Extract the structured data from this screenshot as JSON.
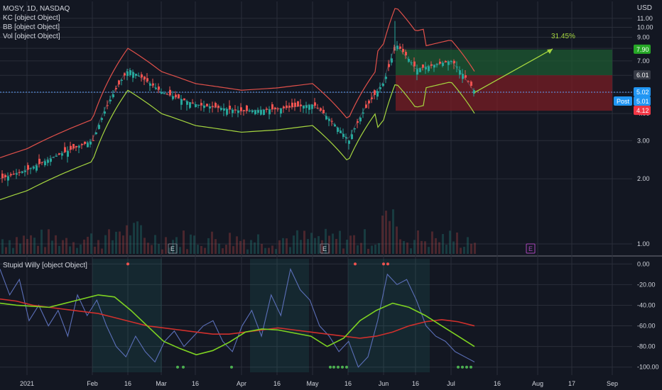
{
  "header": {
    "title": "MOSY, 1D, NASDAQ",
    "indicators": [
      "KC [object Object]",
      "BB [object Object]",
      "Vol [object Object]"
    ],
    "currency": "USD"
  },
  "lower_pane": {
    "title": "Stupid Willy [object Object]"
  },
  "colors": {
    "background": "#131722",
    "grid": "#2a2e39",
    "up": "#26a69a",
    "down": "#ef5350",
    "kc_line": "#e0504a",
    "bb_lower": "#a5d63f",
    "willy": "#5b6fb8",
    "signal_green": "#7ed321",
    "signal_red": "#d0302c",
    "target_zone": "#1e5a32",
    "stop_zone": "#7a1e24"
  },
  "price_badges": [
    {
      "label": "7.90",
      "color": "#26a826"
    },
    {
      "label": "6.01",
      "color": "#363a45"
    },
    {
      "label": "5.02",
      "color": "#2196f3"
    },
    {
      "label": "5.01",
      "color": "#2196f3",
      "prefix": "Post"
    },
    {
      "label": "4.12",
      "color": "#f23645"
    }
  ],
  "position_label": "31.45%",
  "earnings_markers": [
    "E",
    "E",
    "E"
  ],
  "chart_data": [
    {
      "type": "candlestick",
      "title": "MOSY, 1D, NASDAQ",
      "scale": "log",
      "ylim": [
        0.9,
        11.5
      ],
      "y_ticks": [
        "11.00",
        "10.00",
        "9.00",
        "8.00",
        "7.00",
        "6.00",
        "5.00",
        "4.00",
        "3.00",
        "2.00",
        "1.00"
      ],
      "x_ticks": [
        "2021",
        "Feb",
        "16",
        "Mar",
        "16",
        "Apr",
        "16",
        "May",
        "16",
        "Jun",
        "16",
        "Jul",
        "16",
        "Aug",
        "17",
        "Sep"
      ],
      "close_points": [
        [
          "2021",
          2.2
        ],
        [
          "Feb",
          3.0
        ],
        [
          "Feb-16",
          6.4
        ],
        [
          "Mar",
          5.0
        ],
        [
          "Mar-16",
          4.4
        ],
        [
          "Apr",
          4.1
        ],
        [
          "Apr-16",
          4.2
        ],
        [
          "May",
          4.4
        ],
        [
          "May-16",
          3.0
        ],
        [
          "Jun",
          5.6
        ],
        [
          "Jun-06",
          8.3
        ],
        [
          "Jun-16",
          6.4
        ],
        [
          "Jul",
          7.0
        ],
        [
          "Jul-07",
          5.01
        ]
      ],
      "long_position": {
        "entry": 6.01,
        "target": 7.9,
        "stop": 4.12,
        "gain_pct": 31.45
      },
      "last_price": 5.02,
      "post_market": 5.01
    },
    {
      "type": "line",
      "title": "Stupid Willy [object Object]",
      "ylim": [
        -105,
        5
      ],
      "y_ticks": [
        "0.00",
        "-20.00",
        "-40.00",
        "-60.00",
        "-80.00",
        "-100.00"
      ],
      "series": [
        {
          "values": [
            -5,
            -30,
            -15,
            -55,
            -40,
            -60,
            -45,
            -70,
            -30,
            -50,
            -35,
            -60,
            -80,
            -90,
            -70,
            -85,
            -95,
            -75,
            -65,
            -80,
            -70,
            -60,
            -55,
            -75,
            -85,
            -60,
            -45,
            -70,
            -30,
            -50,
            -5,
            -25,
            -35,
            -60,
            -70,
            -85,
            -75,
            -100,
            -90,
            -55,
            -10,
            -20,
            -15,
            -35,
            -60,
            -70,
            -75,
            -85,
            -90,
            -95
          ]
        },
        {
          "values": [
            -38,
            -40,
            -41,
            -42,
            -38,
            -34,
            -30,
            -32,
            -45,
            -60,
            -75,
            -82,
            -88,
            -84,
            -76,
            -66,
            -63,
            -64,
            -67,
            -70,
            -80,
            -72,
            -55,
            -45,
            -38,
            -42,
            -50,
            -60,
            -70,
            -80
          ]
        },
        {
          "values": [
            -34,
            -36,
            -40,
            -42,
            -44,
            -46,
            -48,
            -52,
            -56,
            -60,
            -62,
            -64,
            -66,
            -68,
            -68,
            -66,
            -64,
            -62,
            -64,
            -66,
            -68,
            -70,
            -72,
            -70,
            -66,
            -60,
            -56,
            -54,
            -56,
            -60
          ]
        }
      ]
    }
  ]
}
